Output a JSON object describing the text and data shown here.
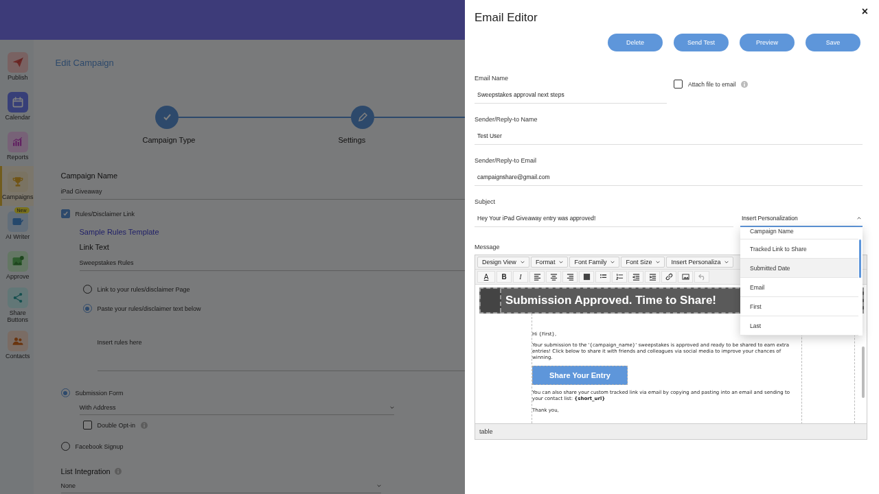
{
  "sidebar": {
    "items": [
      {
        "label": "Publish",
        "selected": false
      },
      {
        "label": "Calendar",
        "selected": false
      },
      {
        "label": "Reports",
        "selected": false
      },
      {
        "label": "Campaigns",
        "selected": true
      },
      {
        "label": "AI Writer",
        "selected": false,
        "badge": "New"
      },
      {
        "label": "Approve",
        "selected": false
      },
      {
        "label": "Share Buttons",
        "selected": false
      },
      {
        "label": "Contacts",
        "selected": false
      }
    ]
  },
  "page": {
    "title": "Edit Campaign",
    "steps": [
      {
        "label": "Campaign Type",
        "kind": "done"
      },
      {
        "label": "Settings",
        "kind": "current"
      }
    ],
    "campaign_name": {
      "label": "Campaign Name",
      "value": "iPad Giveaway"
    },
    "rules": {
      "label": "Rules/Disclaimer Link",
      "checked": true,
      "template_link": "Sample Rules Template",
      "link_text_label": "Link Text",
      "link_text_value": "Sweepstakes Rules",
      "options": [
        {
          "label": "Link to your rules/disclaimer Page",
          "selected": false
        },
        {
          "label": "Paste your rules/disclaimer text below",
          "selected": true
        }
      ],
      "placeholder": "Insert rules here"
    },
    "entry_types": [
      {
        "label": "Submission Form",
        "selected": true,
        "select_value": "With Address",
        "double_opt_in": {
          "label": "Double Opt-in",
          "checked": false
        }
      },
      {
        "label": "Facebook Signup",
        "selected": false
      }
    ],
    "list_integration": {
      "label": "List Integration",
      "value": "None"
    }
  },
  "drawer": {
    "title": "Email Editor",
    "close": "×",
    "buttons": [
      "Delete",
      "Send Test",
      "Preview",
      "Save"
    ],
    "email_name": {
      "label": "Email Name",
      "value": "Sweepstakes approval next steps"
    },
    "attach": {
      "label": "Attach file to email",
      "checked": false
    },
    "sender_name": {
      "label": "Sender/Reply-to Name",
      "value": "Test User"
    },
    "sender_email": {
      "label": "Sender/Reply-to Email",
      "value": "campaignshare@gmail.com"
    },
    "subject": {
      "label": "Subject",
      "value": "Hey Your iPad Giveaway entry was approved!"
    },
    "personalization": {
      "label": "Insert Personalization",
      "expanded": true,
      "options": [
        {
          "label": "Campaign Name",
          "highlighted": false
        },
        {
          "label": "Tracked Link to Share",
          "highlighted": false
        },
        {
          "label": "Submitted Date",
          "highlighted": true
        },
        {
          "label": "Email",
          "highlighted": false
        },
        {
          "label": "First",
          "highlighted": false
        },
        {
          "label": "Last",
          "highlighted": false
        }
      ]
    },
    "message": {
      "label": "Message",
      "menus": [
        "Design View",
        "Format",
        "Font Family",
        "Font Size",
        "Insert Personaliza"
      ],
      "text_color": "A",
      "bold": "B",
      "italic": "I",
      "banner": "Submission Approved. Time to Share!",
      "greeting": "Hi {First},",
      "paragraph": "Your submission to the '{campaign_name}' sweepstakes is approved and ready to be shared to earn extra entries! Click below to share it with friends and colleagues via social media to improve your chances of winning.",
      "cta": "Share Your Entry",
      "paragraph2": "You can also share your custom tracked link via email by copying and pasting into an email and sending to your contact list: **{short_url}**",
      "closing": "Thank you,",
      "status": "table"
    }
  }
}
